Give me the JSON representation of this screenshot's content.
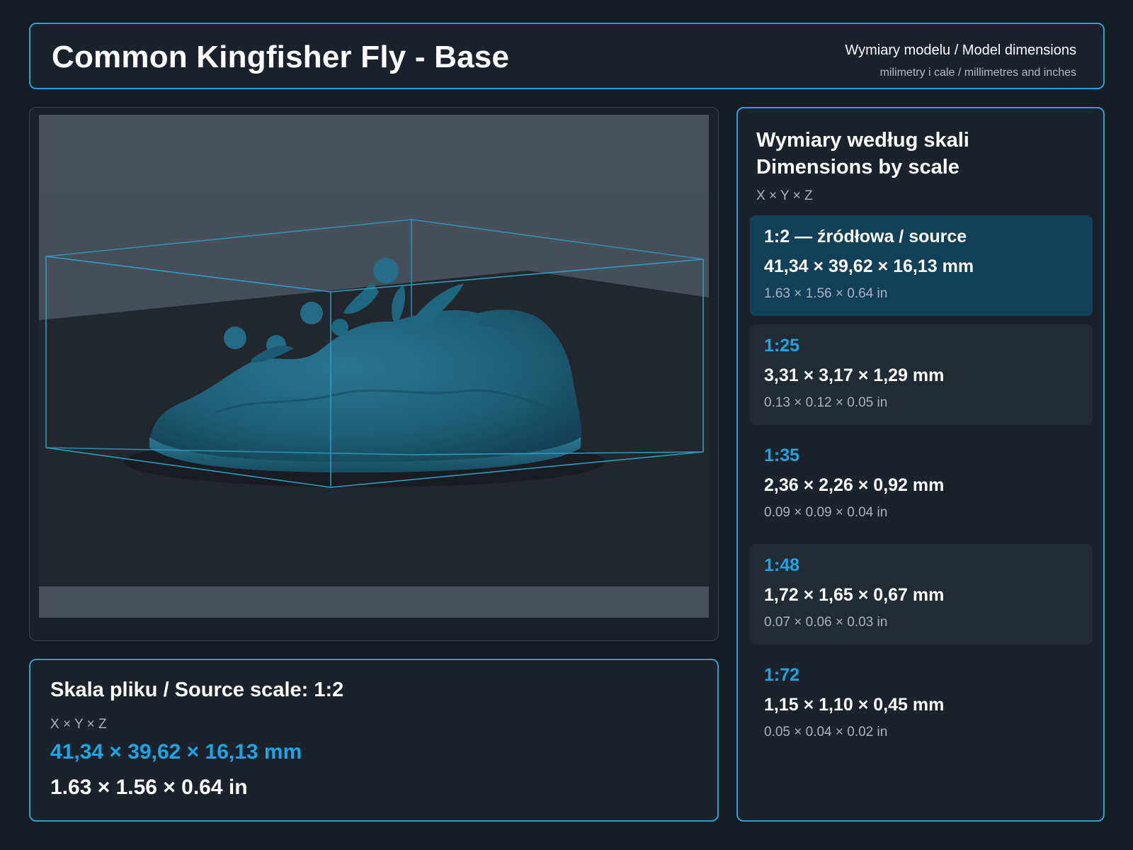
{
  "header": {
    "title": "Common Kingfisher Fly - Base",
    "meta_line1": "Wymiary modelu / Model dimensions",
    "meta_line2": "milimetry i cale / millimetres and inches"
  },
  "viewer": {
    "model_color": "#1e5f78",
    "bbox_color": "#2a9cc0"
  },
  "source": {
    "title": "Skala pliku / Source scale: 1:2",
    "axes": "X × Y × Z",
    "mm": "41,34 × 39,62 × 16,13 mm",
    "inch": "1.63 × 1.56 × 0.64 in"
  },
  "scales": {
    "title": "Wymiary według skali\nDimensions by scale",
    "axes": "X × Y × Z",
    "items": [
      {
        "ratio": "1:2  —  źródłowa / source",
        "mm": "41,34 × 39,62 × 16,13 mm",
        "inch": "1.63 × 1.56 × 0.64 in",
        "selected": true
      },
      {
        "ratio": "1:25",
        "mm": "3,31 × 3,17 × 1,29 mm",
        "inch": "0.13 × 0.12 × 0.05 in",
        "selected": false
      },
      {
        "ratio": "1:35",
        "mm": "2,36 × 2,26 × 0,92 mm",
        "inch": "0.09 × 0.09 × 0.04 in",
        "selected": false
      },
      {
        "ratio": "1:48",
        "mm": "1,72 × 1,65 × 0,67 mm",
        "inch": "0.07 × 0.06 × 0.03 in",
        "selected": false
      },
      {
        "ratio": "1:72",
        "mm": "1,15 × 1,10 × 0,45 mm",
        "inch": "0.05 × 0.04 × 0.02 in",
        "selected": false
      }
    ]
  },
  "colors": {
    "accent": "#22a3da",
    "selected_row": "#114058",
    "background": "#141b23"
  }
}
